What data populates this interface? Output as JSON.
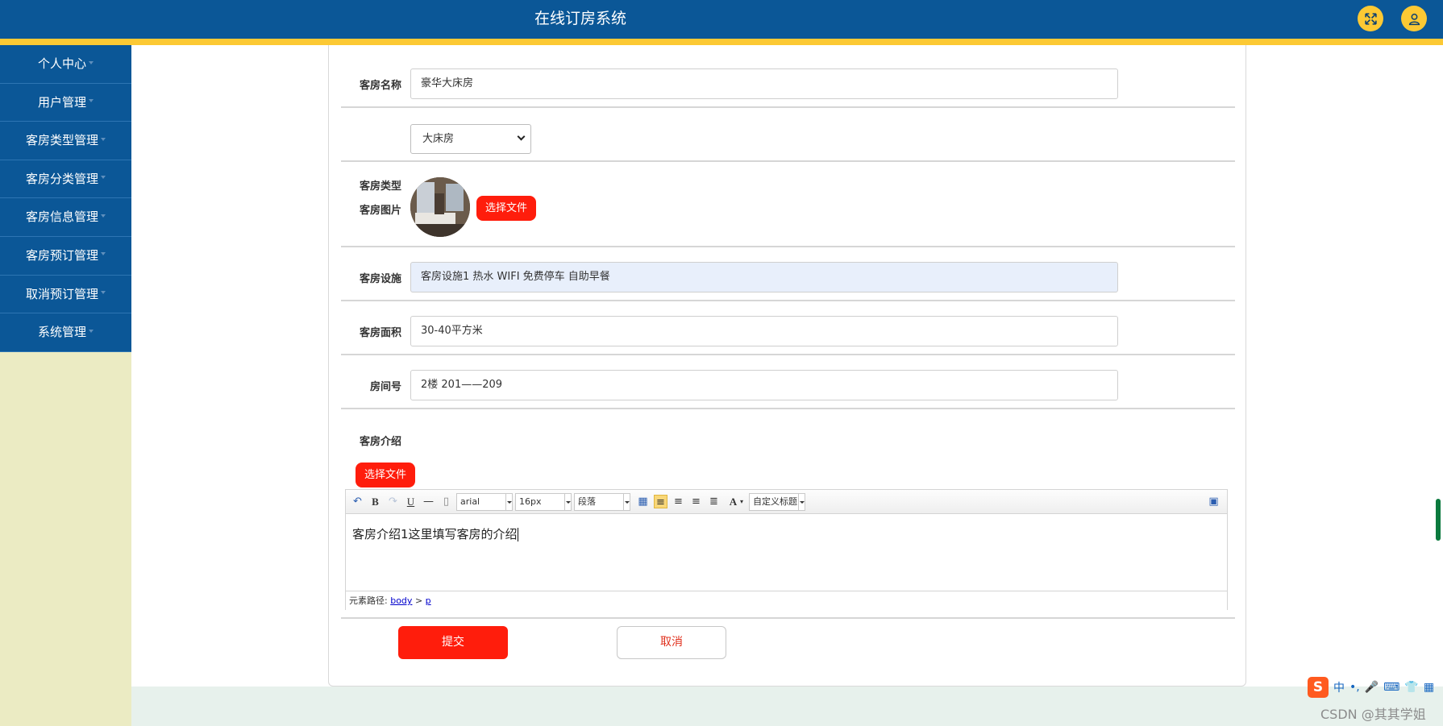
{
  "header": {
    "title": "在线订房系统",
    "fullscreen_icon": "expand-icon",
    "user_icon": "user-icon"
  },
  "sidebar": {
    "items": [
      {
        "label": "个人中心"
      },
      {
        "label": "用户管理"
      },
      {
        "label": "客房类型管理"
      },
      {
        "label": "客房分类管理"
      },
      {
        "label": "客房信息管理"
      },
      {
        "label": "客房预订管理"
      },
      {
        "label": "取消预订管理"
      },
      {
        "label": "系统管理"
      }
    ]
  },
  "form": {
    "name_label": "客房名称",
    "name_value": "豪华大床房",
    "type_label": "客房类型",
    "type_value": "大床房",
    "image_label": "客房图片",
    "image_button": "选择文件",
    "facilities_label": "客房设施",
    "facilities_value": "客房设施1 热水 WIFI 免费停车 自助早餐",
    "area_label": "客房面积",
    "area_value": "30-40平方米",
    "room_no_label": "房间号",
    "room_no_value": "2楼 201——209",
    "intro_label": "客房介绍",
    "intro_file_button": "选择文件",
    "submit_label": "提交",
    "cancel_label": "取消"
  },
  "editor": {
    "font_family": "arial",
    "font_size": "16px",
    "paragraph": "段落",
    "custom_title": "自定义标题",
    "content": "客房介绍1这里填写客房的介绍",
    "path_label": "元素路径:",
    "path_body": "body",
    "path_sep": ">",
    "path_p": "p"
  },
  "taskbar": {
    "ime_lang": "中",
    "watermark": "CSDN @其其学姐"
  },
  "colors": {
    "header_bg": "#0b5797",
    "accent_yellow": "#fcc934",
    "danger_red": "#ff1d0c",
    "sidebar_bg": "#ebebc3"
  }
}
